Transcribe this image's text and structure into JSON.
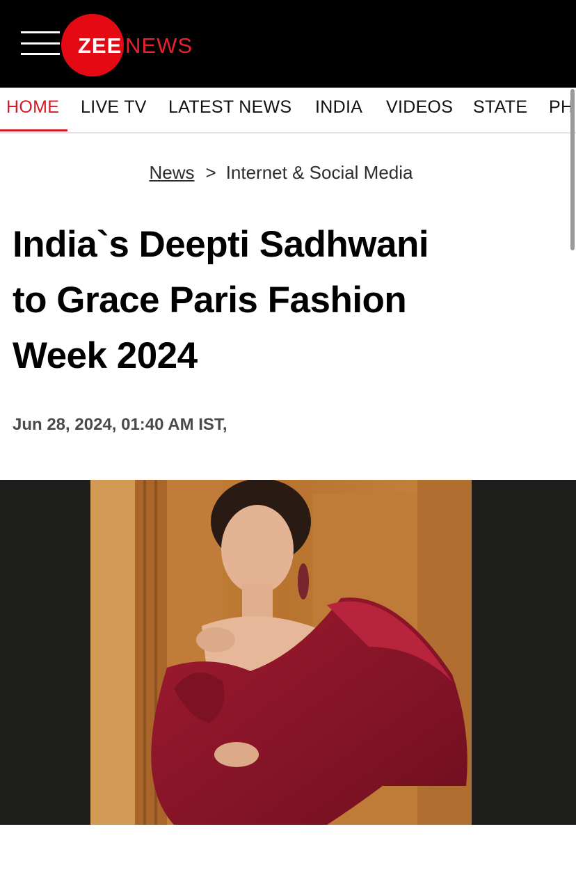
{
  "header": {
    "logo": {
      "zee": "ZEE",
      "news": "NEWS"
    },
    "menu_icon": "hamburger-menu-icon"
  },
  "nav": {
    "items": [
      {
        "label": "HOME",
        "active": true
      },
      {
        "label": "LIVE TV",
        "active": false
      },
      {
        "label": "LATEST NEWS",
        "active": false
      },
      {
        "label": "INDIA",
        "active": false
      },
      {
        "label": "VIDEOS",
        "active": false
      },
      {
        "label": "STATE",
        "active": false
      },
      {
        "label": "PH",
        "active": false
      }
    ]
  },
  "breadcrumb": {
    "root": "News",
    "separator": ">",
    "section": "Internet & Social Media"
  },
  "article": {
    "headline_lines": [
      "India`s Deepti Sadhwani",
      "to Grace Paris Fashion",
      "Week 2024"
    ],
    "dateline": "Jun 28, 2024, 01:40 AM IST,"
  },
  "colors": {
    "brand_red": "#e50914",
    "nav_active": "#d51a27",
    "header_bg": "#000000",
    "media_bg": "#1e1e1c",
    "gown": "#8e1428"
  }
}
